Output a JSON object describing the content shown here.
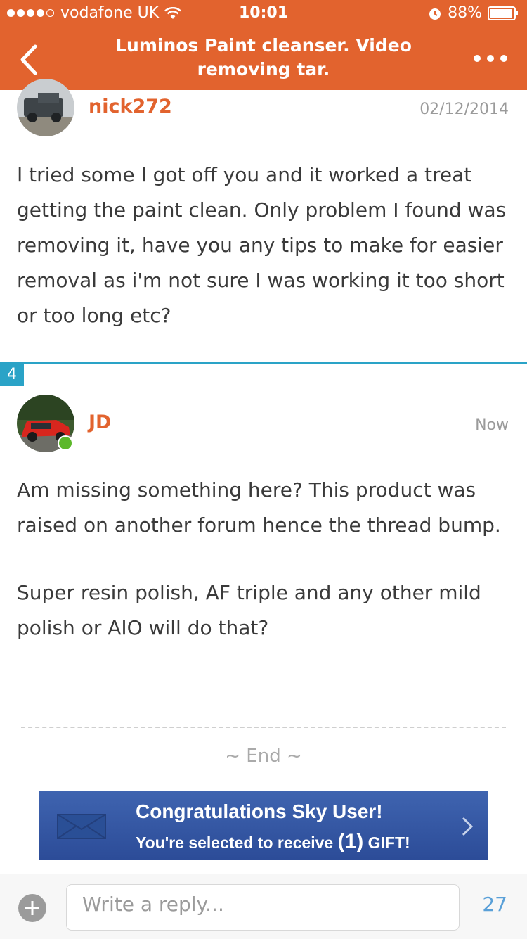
{
  "status_bar": {
    "carrier": "vodafone UK",
    "time": "10:01",
    "battery": "88%"
  },
  "nav": {
    "title": "Luminos Paint cleanser. Video removing tar."
  },
  "posts": [
    {
      "username": "nick272",
      "date": "02/12/2014",
      "body": [
        "I tried some I got off you and it worked a treat getting the paint clean. Only problem I found was removing it, have you any tips to make for easier removal as i'm not sure I was working it too short or too long etc?"
      ]
    },
    {
      "number": "4",
      "username": "JD",
      "date": "Now",
      "online": true,
      "body": [
        "Am missing something here? This product was raised on another forum hence the thread bump.",
        "Super resin polish, AF triple and any other mild polish or AIO will do that?"
      ]
    }
  ],
  "thread_end": "~ End ~",
  "ad": {
    "line1": "Congratulations Sky User!",
    "line2_pre": "You're selected to receive",
    "gift_count": "(1)",
    "line2_post": "GIFT!"
  },
  "reply": {
    "placeholder": "Write a reply...",
    "count": "27"
  },
  "colors": {
    "header": "#e2632e",
    "username": "#e2632e",
    "divider": "#2aa3c7",
    "online": "#5cb82a",
    "count": "#5aa0d8"
  }
}
